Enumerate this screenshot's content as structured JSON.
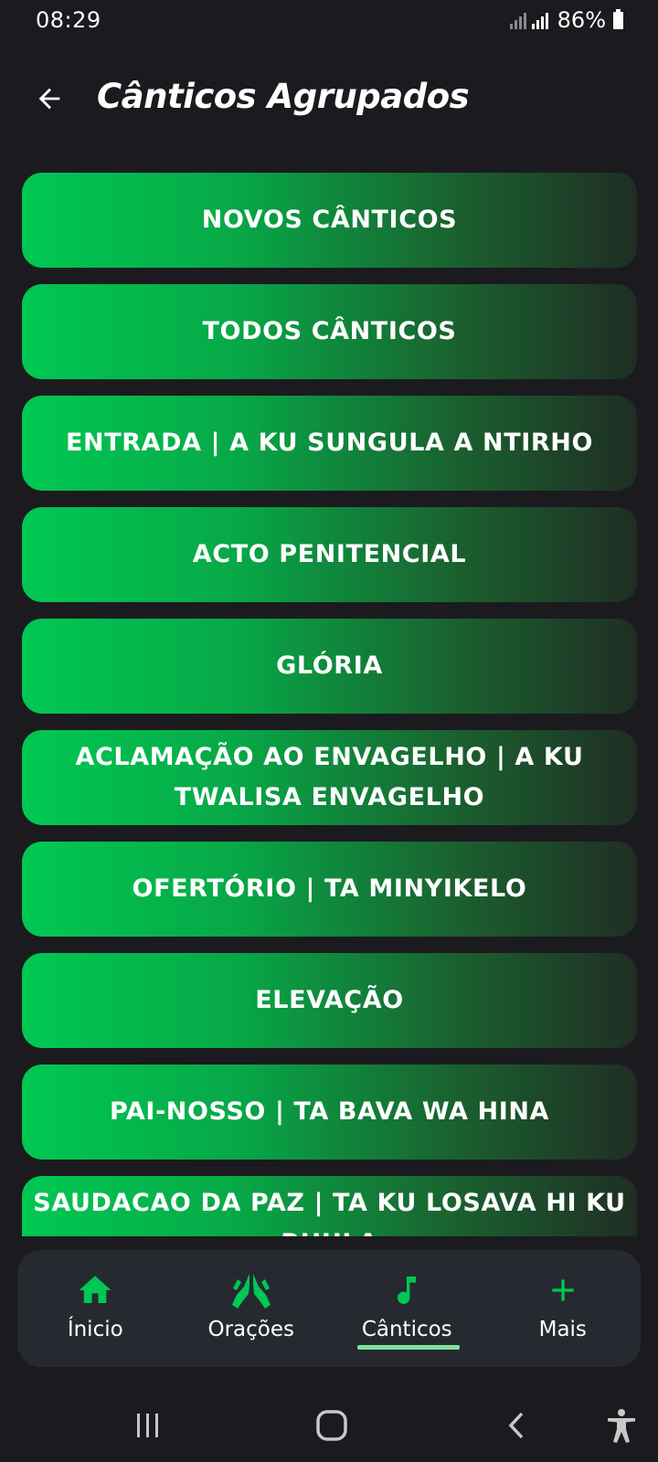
{
  "status_bar": {
    "time": "08:29",
    "battery_percent": "86%"
  },
  "header": {
    "title": "Cânticos Agrupados",
    "back_icon": "arrow-left-icon"
  },
  "categories": [
    {
      "label": "NOVOS CÂNTICOS"
    },
    {
      "label": "TODOS CÂNTICOS"
    },
    {
      "label": "ENTRADA | A KU SUNGULA A NTIRHO"
    },
    {
      "label": "ACTO PENITENCIAL"
    },
    {
      "label": "GLÓRIA"
    },
    {
      "label": "ACLAMAÇÃO AO ENVAGELHO | A KU TWALISA ENVAGELHO"
    },
    {
      "label": "OFERTÓRIO | TA MINYIKELO"
    },
    {
      "label": "ELEVAÇÃO"
    },
    {
      "label": "PAI-NOSSO | TA BAVA WA HINA"
    },
    {
      "label": "SAUDACAO DA PAZ | TA KU LOSAVA HI KU RHULA"
    }
  ],
  "bottom_nav": {
    "items": [
      {
        "label": "Ínicio",
        "icon": "home-icon"
      },
      {
        "label": "Orações",
        "icon": "praying-hands-icon"
      },
      {
        "label": "Cânticos",
        "icon": "music-note-icon",
        "active": true
      },
      {
        "label": "Mais",
        "icon": "plus-icon"
      }
    ]
  },
  "colors": {
    "accent": "#00c853",
    "background": "#1b1b1f",
    "nav_background": "#262a30",
    "active_indicator": "#7ee29b"
  }
}
